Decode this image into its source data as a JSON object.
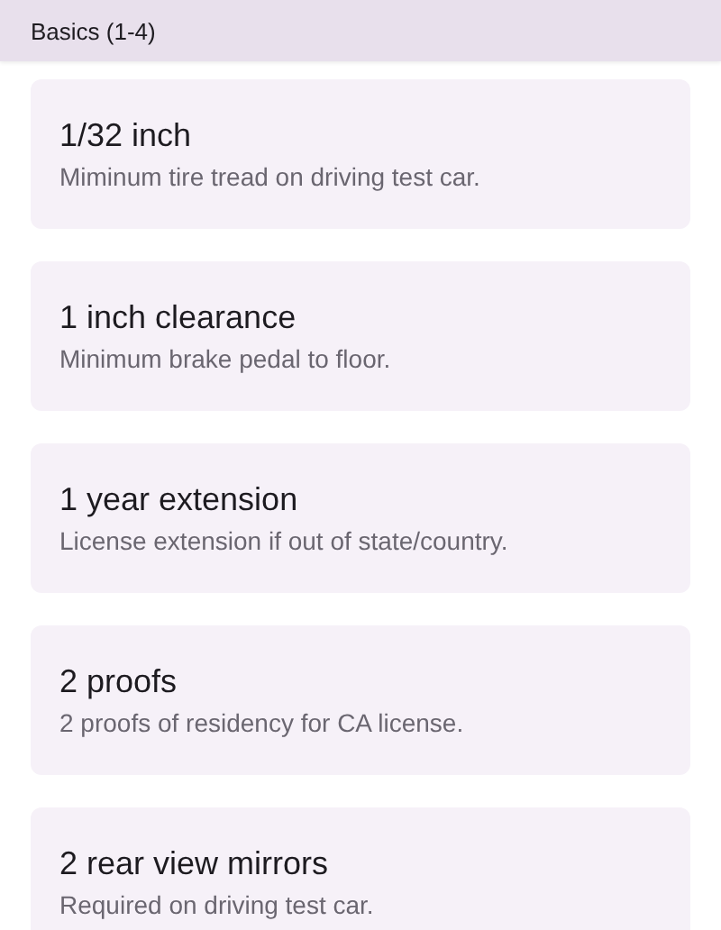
{
  "header": {
    "title": "Basics (1-4)"
  },
  "cards": [
    {
      "title": "1/32 inch",
      "subtitle": "Miminum tire tread on driving test car."
    },
    {
      "title": "1 inch clearance",
      "subtitle": "Minimum brake pedal to floor."
    },
    {
      "title": "1 year extension",
      "subtitle": "License extension if out of state/country."
    },
    {
      "title": "2 proofs",
      "subtitle": "2 proofs of residency for CA license."
    },
    {
      "title": "2 rear view mirrors",
      "subtitle": "Required on driving test car."
    }
  ]
}
